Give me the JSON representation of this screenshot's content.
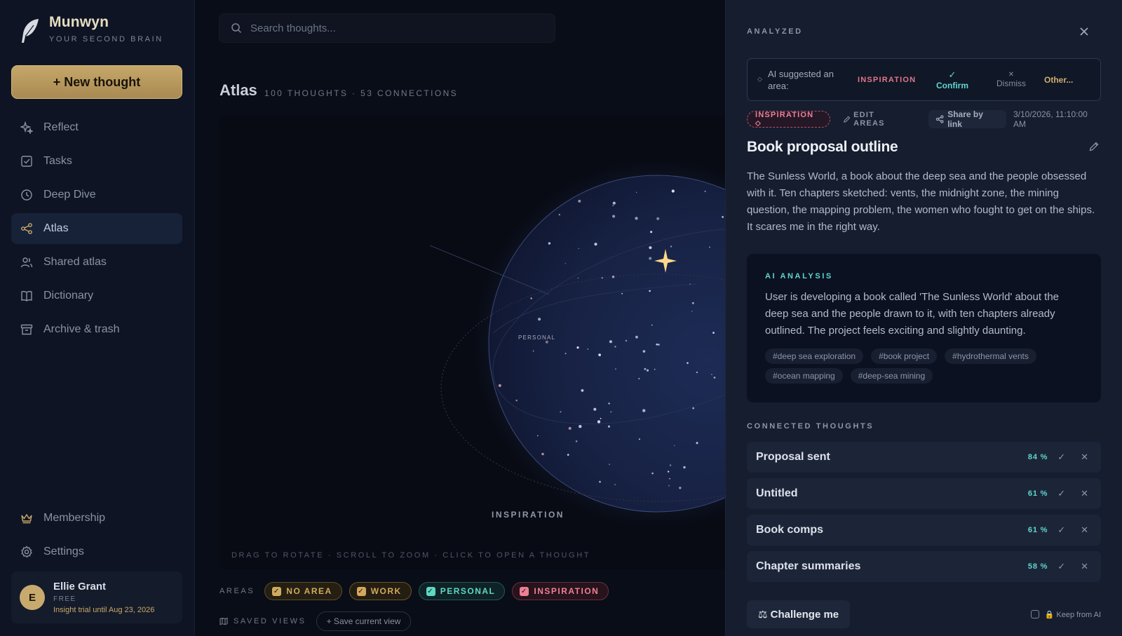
{
  "brand": {
    "name": "Munwyn",
    "tagline": "YOUR SECOND BRAIN"
  },
  "sidebar": {
    "new_button": "+ New thought",
    "items": [
      {
        "label": "Reflect",
        "icon": "sparkle-icon"
      },
      {
        "label": "Tasks",
        "icon": "checkbox-icon"
      },
      {
        "label": "Deep Dive",
        "icon": "clock-icon"
      },
      {
        "label": "Atlas",
        "icon": "share-nodes-icon",
        "active": true
      },
      {
        "label": "Shared atlas",
        "icon": "users-icon"
      },
      {
        "label": "Dictionary",
        "icon": "book-icon"
      },
      {
        "label": "Archive & trash",
        "icon": "archive-icon"
      }
    ],
    "bottom_items": [
      {
        "label": "Membership",
        "icon": "crown-icon"
      },
      {
        "label": "Settings",
        "icon": "gear-icon"
      }
    ],
    "user": {
      "initial": "E",
      "name": "Ellie Grant",
      "plan": "FREE",
      "trial": "Insight trial until Aug 23, 2026"
    }
  },
  "main": {
    "search_placeholder": "Search thoughts...",
    "title": "Atlas",
    "meta": "100 THOUGHTS · 53 CONNECTIONS",
    "canvas": {
      "labels": {
        "personal": "PERSONAL",
        "inspiration": "INSPIRATION"
      },
      "hint": "DRAG TO ROTATE · SCROLL TO ZOOM · CLICK TO OPEN A THOUGHT"
    },
    "areas_label": "AREAS",
    "areas": [
      {
        "label": "NO AREA",
        "color": "#d0ab5e",
        "bg": "#2a2414",
        "border": "#5e4d28"
      },
      {
        "label": "WORK",
        "color": "#d4a85a",
        "bg": "#2a2214",
        "border": "#6a532a"
      },
      {
        "label": "PERSONAL",
        "color": "#5fd7c4",
        "bg": "#10262a",
        "border": "#23595a"
      },
      {
        "label": "INSPIRATION",
        "color": "#ef7f95",
        "bg": "#2a1520",
        "border": "#6a2e40"
      }
    ],
    "saved_views_label": "SAVED VIEWS",
    "save_view_button": "+ Save current view"
  },
  "panel": {
    "status": "ANALYZED",
    "suggestion": {
      "text": "AI suggested an area:",
      "area": "INSPIRATION",
      "confirm": "Confirm",
      "dismiss": "Dismiss",
      "other": "Other..."
    },
    "area_pill": "INSPIRATION ⬦",
    "edit_areas": "EDIT AREAS",
    "share": "Share by link",
    "timestamp": "3/10/2026, 11:10:00 AM",
    "title": "Book proposal outline",
    "body": "The Sunless World, a book about the deep sea and the people obsessed with it. Ten chapters sketched: vents, the midnight zone, the mining question, the mapping problem, the women who fought to get on the ships. It scares me in the right way.",
    "analysis": {
      "label": "AI ANALYSIS",
      "text": "User is developing a book called 'The Sunless World' about the deep sea and the people drawn to it, with ten chapters already outlined. The project feels exciting and slightly daunting.",
      "tags": [
        "#deep sea exploration",
        "#book project",
        "#hydrothermal vents",
        "#ocean mapping",
        "#deep-sea mining"
      ]
    },
    "connected_label": "CONNECTED THOUGHTS",
    "connected": [
      {
        "title": "Proposal sent",
        "pct": "84 %"
      },
      {
        "title": "Untitled",
        "pct": "61 %"
      },
      {
        "title": "Book comps",
        "pct": "61 %"
      },
      {
        "title": "Chapter summaries",
        "pct": "58 %"
      }
    ],
    "challenge": "⚖ Challenge me",
    "keep_from_ai": "🔒 Keep from AI"
  }
}
